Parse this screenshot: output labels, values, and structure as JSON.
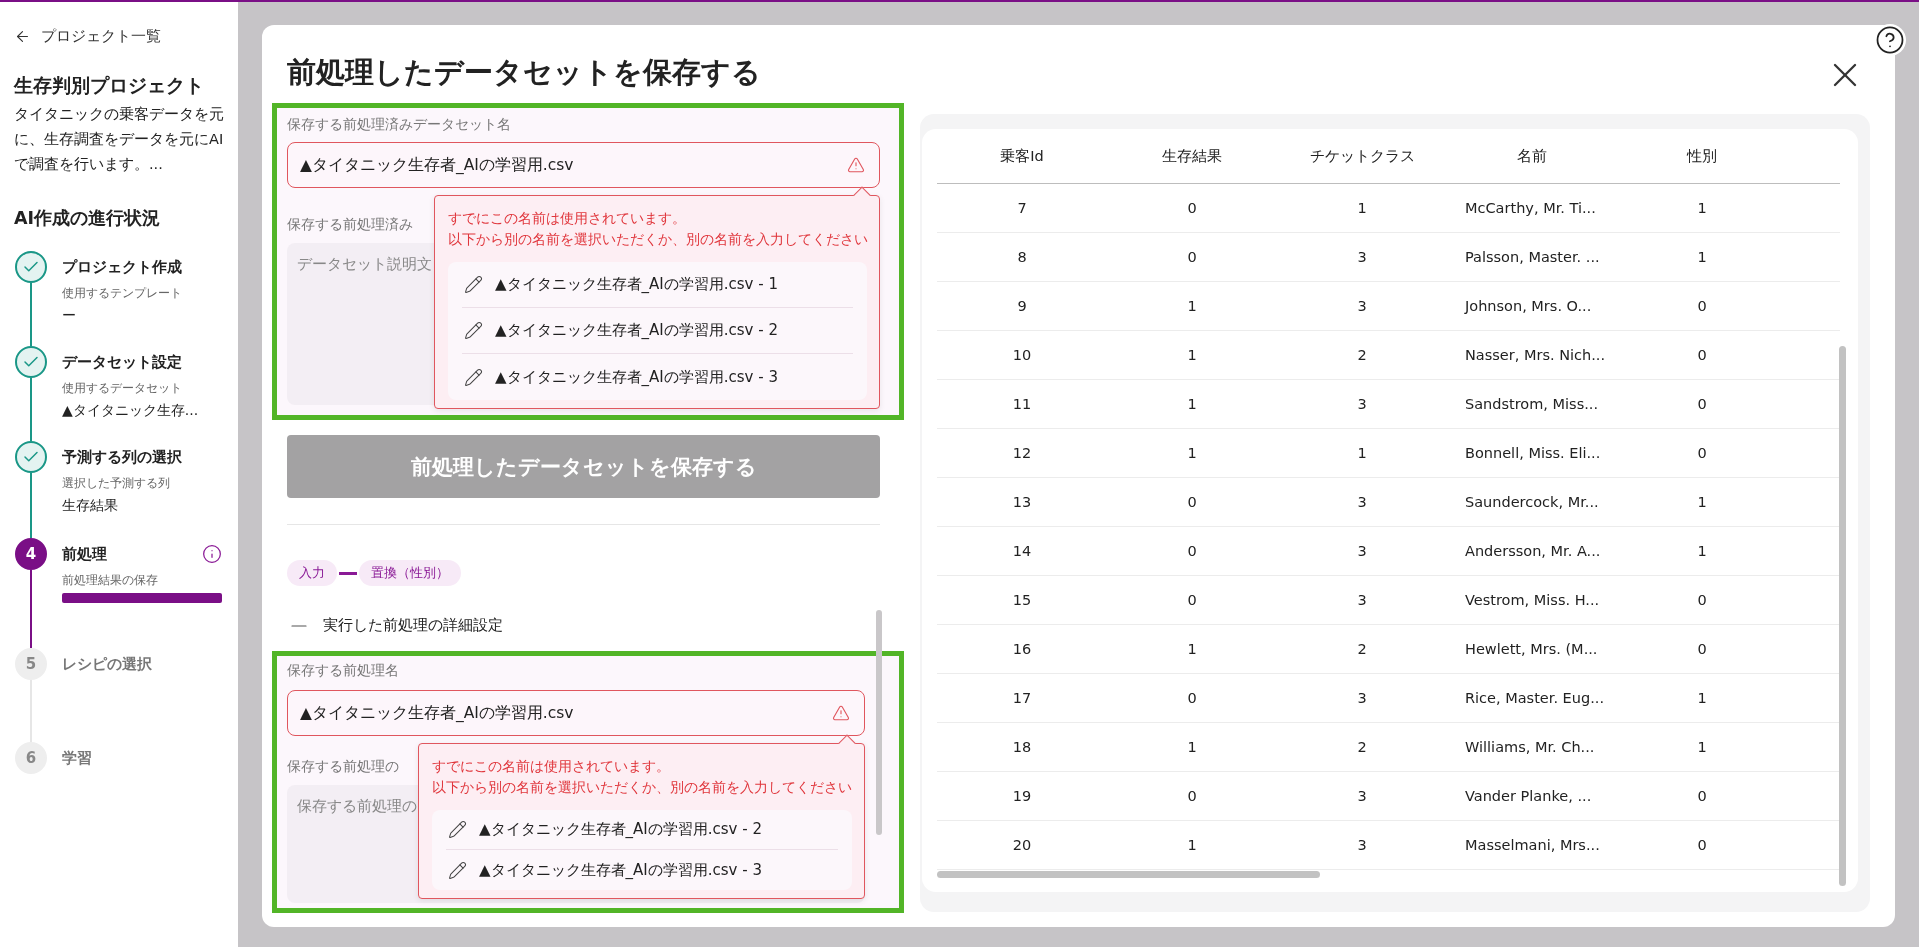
{
  "sidebar": {
    "back_link": "プロジェクト一覧",
    "project_title": "生存判別プロジェクト",
    "project_description": "タイタニックの乗客データを元に、生存調査をデータを元にAIで調査を行います。...",
    "progress_heading": "AI作成の進行状況",
    "steps": [
      {
        "kind": "done",
        "title": "プロジェクト作成",
        "subtitle": "使用するテンプレート",
        "value": "ー"
      },
      {
        "kind": "done",
        "title": "データセット設定",
        "subtitle": "使用するデータセット",
        "value": "▲タイタニック生存..."
      },
      {
        "kind": "done",
        "title": "予測する列の選択",
        "subtitle": "選択した予測する列",
        "value": "生存結果"
      },
      {
        "kind": "active",
        "number": "4",
        "title": "前処理",
        "subtitle": "前処理結果の保存",
        "level": 1,
        "info": true
      },
      {
        "kind": "pending",
        "number": "5",
        "title": "レシピの選択"
      },
      {
        "kind": "pending",
        "number": "6",
        "title": "学習"
      }
    ]
  },
  "dialog": {
    "title": "前処理したデータセットを保存する",
    "dataset_section": {
      "highlighted": true,
      "name_label": "保存する前処理済みデータセット名",
      "name_value": "▲タイタニック生存者_AIの学習用.csv",
      "name_error": true,
      "description_label": "保存する前処理済み",
      "description_placeholder": "データセット説明文",
      "popup": {
        "message": [
          "すでにこの名前は使用されています。",
          "以下から別の名前を選択いただくか、別の名前を入力してください"
        ],
        "suggestions": [
          "▲タイタニック生存者_AIの学習用.csv - 1",
          "▲タイタニック生存者_AIの学習用.csv - 2",
          "▲タイタニック生存者_AIの学習用.csv - 3"
        ]
      }
    },
    "save_button": {
      "label": "前処理したデータセットを保存する",
      "disabled": true
    },
    "pipeline": [
      {
        "label": "入力"
      },
      {
        "label": "置換（性別）"
      }
    ],
    "detail_toggle": {
      "label": "実行した前処理の詳細設定"
    },
    "preprocess_section": {
      "highlighted": true,
      "name_label": "保存する前処理名",
      "name_value": "▲タイタニック生存者_AIの学習用.csv",
      "name_error": true,
      "description_label": "保存する前処理の",
      "description_placeholder": "保存する前処理の",
      "popup": {
        "message": [
          "すでにこの名前は使用されています。",
          "以下から別の名前を選択いただくか、別の名前を入力してください"
        ],
        "suggestions": [
          "▲タイタニック生存者_AIの学習用.csv - 2",
          "▲タイタニック生存者_AIの学習用.csv - 3"
        ]
      }
    },
    "table": {
      "columns": [
        "乗客Id",
        "生存結果",
        "チケットクラス",
        "名前",
        "性別"
      ],
      "rows": [
        [
          "7",
          "0",
          "1",
          "McCarthy, Mr. Ti...",
          "1"
        ],
        [
          "8",
          "0",
          "3",
          "Palsson, Master. ...",
          "1"
        ],
        [
          "9",
          "1",
          "3",
          "Johnson, Mrs. O...",
          "0"
        ],
        [
          "10",
          "1",
          "2",
          "Nasser, Mrs. Nich...",
          "0"
        ],
        [
          "11",
          "1",
          "3",
          "Sandstrom, Miss...",
          "0"
        ],
        [
          "12",
          "1",
          "1",
          "Bonnell, Miss. Eli...",
          "0"
        ],
        [
          "13",
          "0",
          "3",
          "Saundercock, Mr...",
          "1"
        ],
        [
          "14",
          "0",
          "3",
          "Andersson, Mr. A...",
          "1"
        ],
        [
          "15",
          "0",
          "3",
          "Vestrom, Miss. H...",
          "0"
        ],
        [
          "16",
          "1",
          "2",
          "Hewlett, Mrs. (M...",
          "0"
        ],
        [
          "17",
          "0",
          "3",
          "Rice, Master. Eug...",
          "1"
        ],
        [
          "18",
          "1",
          "2",
          "Williams, Mr. Ch...",
          "1"
        ],
        [
          "19",
          "0",
          "3",
          "Vander Planke, ...",
          "0"
        ],
        [
          "20",
          "1",
          "3",
          "Masselmani, Mrs...",
          "0"
        ]
      ]
    }
  }
}
